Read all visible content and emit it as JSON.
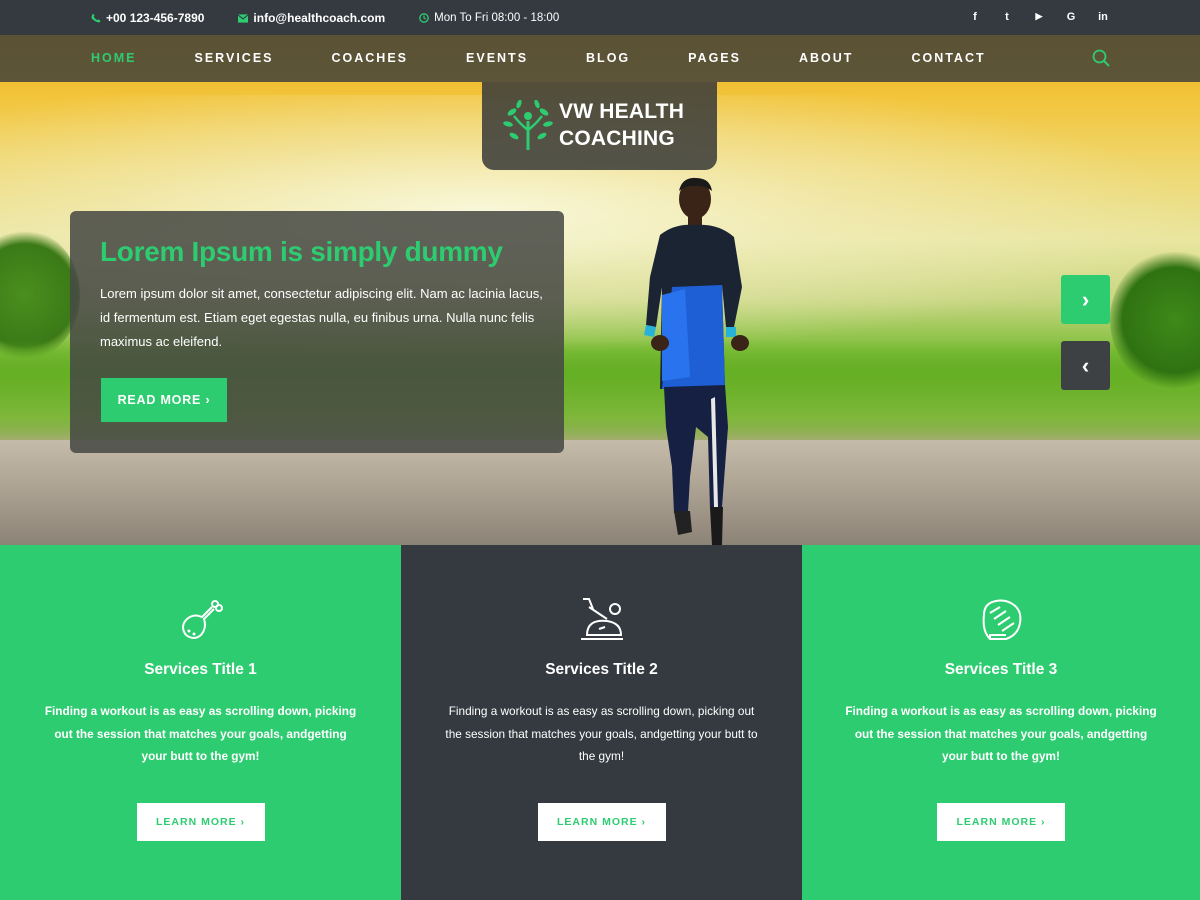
{
  "topbar": {
    "phone": "+00 123-456-7890",
    "email": "info@healthcoach.com",
    "hours": "Mon To Fri 08:00 - 18:00",
    "socials": [
      "f",
      "t",
      "▶",
      "G",
      "in"
    ]
  },
  "nav": {
    "items": [
      "HOME",
      "SERVICES",
      "COACHES",
      "EVENTS",
      "BLOG",
      "PAGES",
      "ABOUT",
      "CONTACT"
    ],
    "active": "HOME"
  },
  "logo": {
    "line1": "VW HEALTH",
    "line2": "COACHING"
  },
  "slide": {
    "title": "Lorem Ipsum is simply dummy",
    "text": "Lorem ipsum dolor sit amet, consectetur adipiscing elit. Nam ac lacinia lacus, id fermentum est. Etiam eget egestas nulla, eu finibus urna. Nulla nunc felis maximus ac eleifend.",
    "button": "READ MORE  ›"
  },
  "slider": {
    "next": "›",
    "prev": "‹"
  },
  "services": [
    {
      "title": "Services Title 1",
      "text": "Finding a workout is as easy as scrolling down, picking out the session that matches your goals, andgetting your butt to the gym!",
      "button": "LEARN MORE  ›",
      "icon": "drumstick-icon"
    },
    {
      "title": "Services Title 2",
      "text": "Finding a workout is as easy as scrolling down, picking out the session that matches your goals, andgetting your butt to the gym!",
      "button": "LEARN MORE  ›",
      "icon": "exercise-bike-icon"
    },
    {
      "title": "Services Title 3",
      "text": "Finding a workout is as easy as scrolling down, picking out the session that matches your goals, andgetting your butt to the gym!",
      "button": "LEARN MORE  ›",
      "icon": "boxing-glove-icon"
    }
  ],
  "colors": {
    "accent": "#2ecc71",
    "dark": "#343a40"
  }
}
